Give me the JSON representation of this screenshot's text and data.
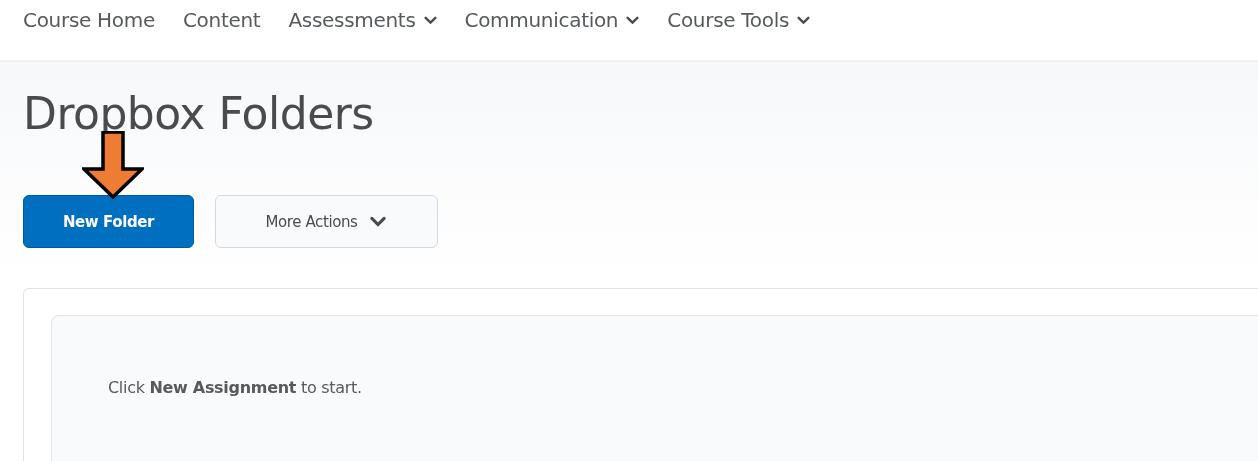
{
  "nav": [
    {
      "label": "Course Home",
      "has_menu": false
    },
    {
      "label": "Content",
      "has_menu": false
    },
    {
      "label": "Assessments",
      "has_menu": true
    },
    {
      "label": "Communication",
      "has_menu": true
    },
    {
      "label": "Course Tools",
      "has_menu": true
    }
  ],
  "page_title": "Dropbox Folders",
  "buttons": [
    {
      "label": "New Folder",
      "kind": "primary",
      "has_menu": false
    },
    {
      "label": "More Actions",
      "kind": "secondary",
      "has_menu": true
    }
  ],
  "empty_message": "Click **New Assignment** to start."
}
